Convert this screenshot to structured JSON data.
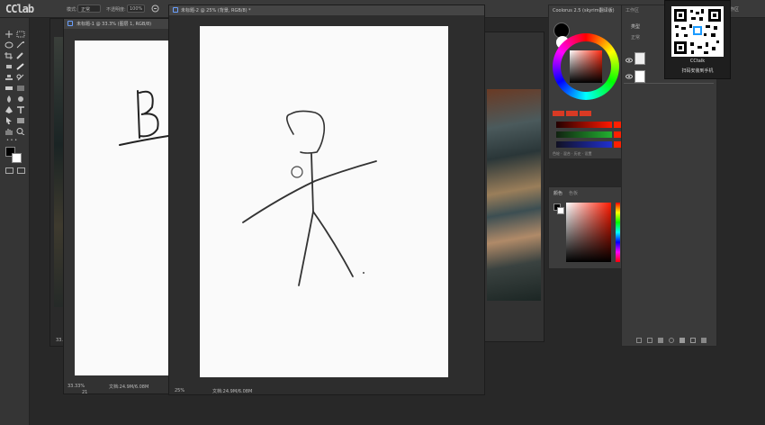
{
  "app": {
    "logo": "CClab"
  },
  "optionsbar": {
    "mode_label": "模式:",
    "mode_value": "正常",
    "opacity_label": "不透明度:",
    "opacity_value": "100%"
  },
  "windows": {
    "back_doc": {
      "tab": "未标题-1 @ 33.3% (图层 1, RGB/8)",
      "zoom": "33.33%",
      "doc": "文档:24.9M/6.08M",
      "extra": "21"
    },
    "front_doc": {
      "tab": "未标题-2 @ 25% (背景, RGB/8) *",
      "zoom": "25%",
      "doc": "文档:24.9M/6.08M"
    },
    "left_mid_zoom": "33.3"
  },
  "coolorus": {
    "title": "Coolorus 2.5 (skyrim翻译版)",
    "chips": [
      "HSL",
      "RGB",
      "LAB"
    ],
    "row_labels": [
      "R",
      "G",
      "B"
    ],
    "tabs": [
      "颜色",
      "色板"
    ],
    "bottom_row": "色轮 · 混合 · 历史 · 设置"
  },
  "color_panel": {
    "tabs": [
      "颜色",
      "色板"
    ]
  },
  "layers_panel": {
    "workspace": "工作区",
    "tabs": [
      "类型"
    ],
    "label": "正常"
  },
  "qr": {
    "caption_1": "CCtalk",
    "caption_2": "扫码安装到手机"
  },
  "drawing": {
    "letter": "B"
  }
}
